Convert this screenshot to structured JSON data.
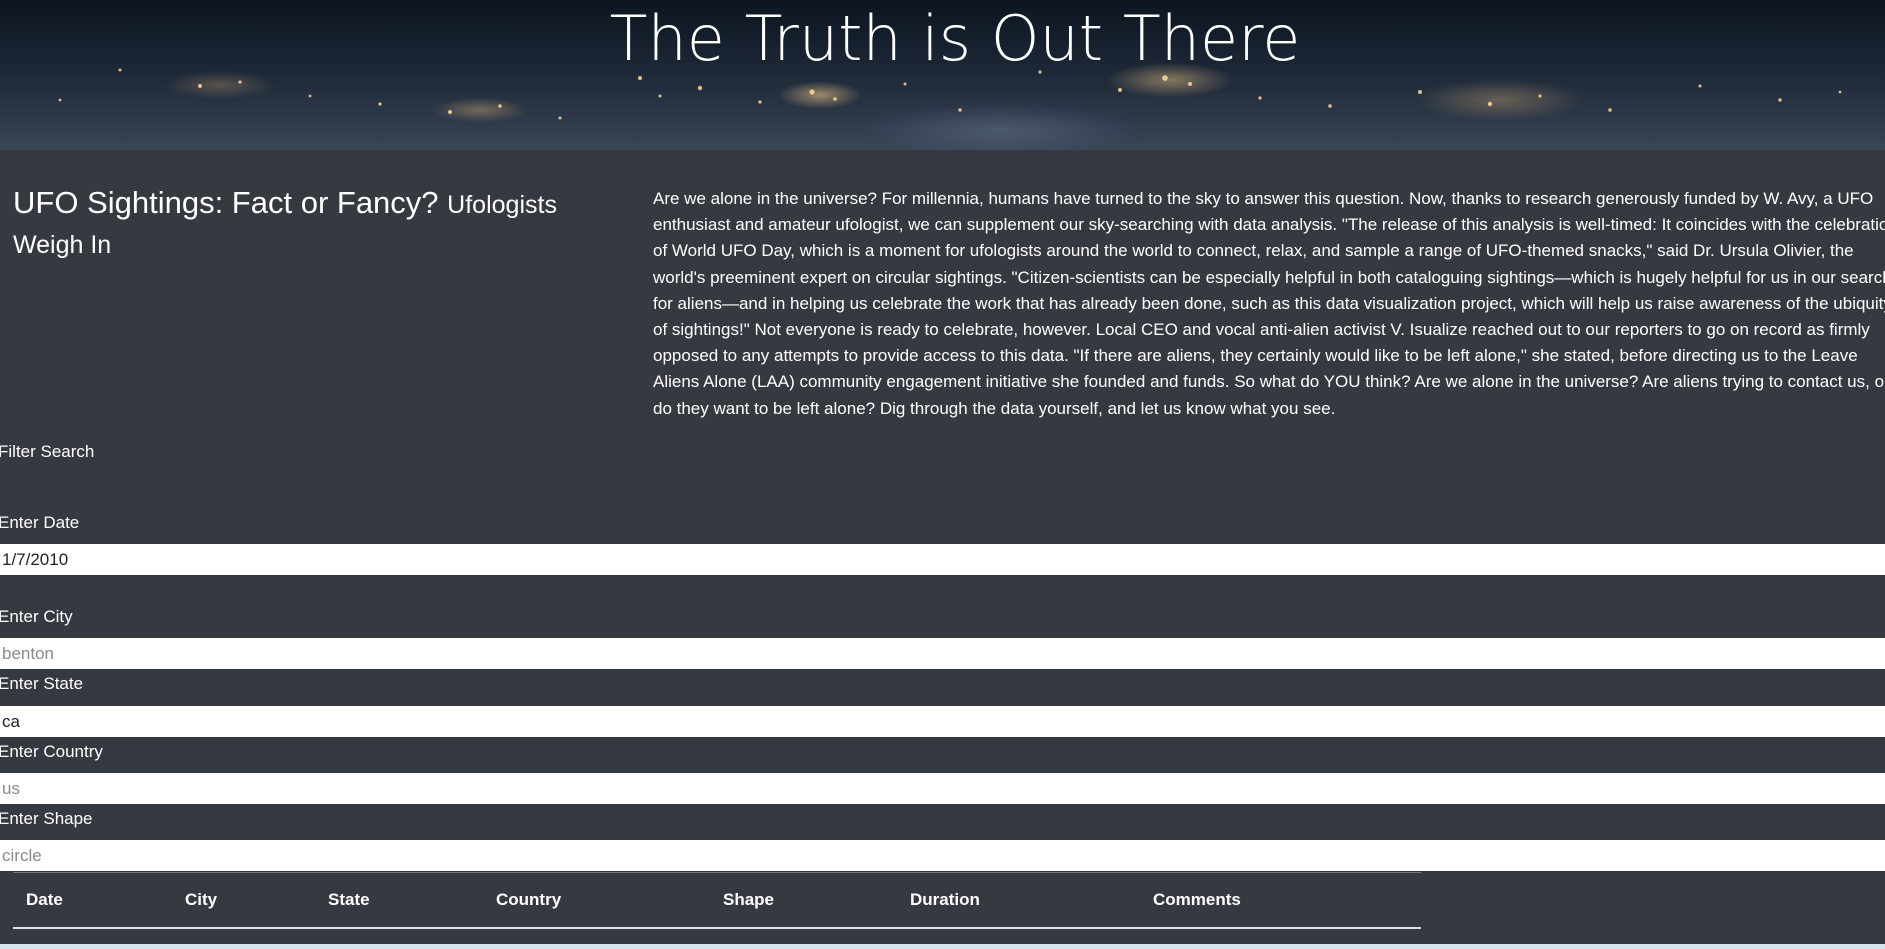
{
  "hero": {
    "title": "The Truth is Out There"
  },
  "headline": {
    "main": "UFO Sightings: Fact or Fancy?",
    "sub": "Ufologists Weigh In"
  },
  "article": {
    "body": "Are we alone in the universe? For millennia, humans have turned to the sky to answer this question. Now, thanks to research generously funded by W. Avy, a UFO enthusiast and amateur ufologist, we can supplement our sky-searching with data analysis. \"The release of this analysis is well-timed: It coincides with the celebration of World UFO Day, which is a moment for ufologists around the world to connect, relax, and sample a range of UFO-themed snacks,\" said Dr. Ursula Olivier, the world's preeminent expert on circular sightings. \"Citizen-scientists can be especially helpful in both cataloguing sightings—which is hugely helpful for us in our search for aliens—and in helping us celebrate the work that has already been done, such as this data visualization project, which will help us raise awareness of the ubiquity of sightings!\" Not everyone is ready to celebrate, however. Local CEO and vocal anti-alien activist V. Isualize reached out to our reporters to go on record as firmly opposed to any attempts to provide access to this data. \"If there are aliens, they certainly would like to be left alone,\" she stated, before directing us to the Leave Aliens Alone (LAA) community engagement initiative she founded and funds. So what do YOU think? Are we alone in the universe? Are aliens trying to contact us, or do they want to be left alone? Dig through the data yourself, and let us know what you see."
  },
  "filters": {
    "heading": "Filter Search",
    "date": {
      "label": "Enter Date",
      "value": "1/7/2010",
      "placeholder": ""
    },
    "city": {
      "label": "Enter City",
      "value": "",
      "placeholder": "benton"
    },
    "state": {
      "label": "Enter State",
      "value": "ca",
      "placeholder": ""
    },
    "country": {
      "label": "Enter Country",
      "value": "",
      "placeholder": "us"
    },
    "shape": {
      "label": "Enter Shape",
      "value": "",
      "placeholder": "circle"
    }
  },
  "table": {
    "columns": [
      "Date",
      "City",
      "State",
      "Country",
      "Shape",
      "Duration",
      "Comments"
    ]
  }
}
